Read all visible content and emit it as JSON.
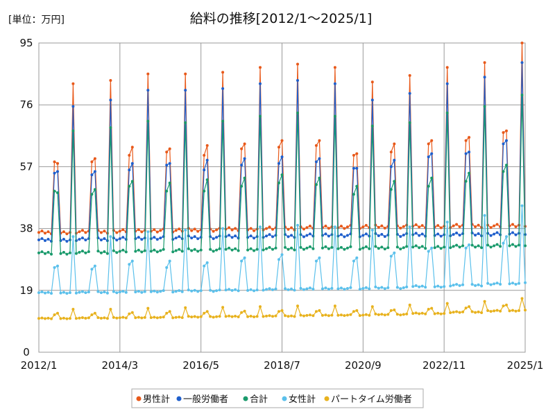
{
  "chart_data": {
    "type": "line",
    "title": "給料の推移[2012/1～2025/1]",
    "unit_label": "[単位：万円]",
    "x_start": "2012-01",
    "x_end": "2025-01",
    "x_tick_labels": [
      "2012/1",
      "2014/3",
      "2016/5",
      "2018/7",
      "2020/9",
      "2022/11",
      "2025/1"
    ],
    "y_tick_labels": [
      "0",
      "19",
      "38",
      "57",
      "76",
      "95"
    ],
    "ylim": [
      0,
      95
    ],
    "grid": true,
    "legend_position": "bottom",
    "series": [
      {
        "name": "男性計",
        "color": "#E8591A",
        "base": [
          36.8,
          37.0,
          37.2,
          37.4,
          37.6,
          37.8,
          38.0,
          38.3,
          38.5,
          38.6,
          38.7,
          38.8,
          38.8,
          38.9
        ],
        "june": [
          58.5,
          58.5,
          60.5,
          61.5,
          60.5,
          62.5,
          63.0,
          63.5,
          60.5,
          61.5,
          64.0,
          65.0,
          67.5,
          null
        ],
        "july": [
          58.0,
          59.5,
          63.0,
          62.5,
          63.5,
          64.0,
          65.0,
          65.0,
          61.0,
          64.0,
          65.0,
          66.0,
          68.0,
          null
        ],
        "dec": [
          82.5,
          83.5,
          85.5,
          85.5,
          86.0,
          87.5,
          88.5,
          87.5,
          83.0,
          85.0,
          87.5,
          89.0,
          95.0,
          null
        ]
      },
      {
        "name": "一般労働者",
        "color": "#1F5FCC",
        "base": [
          34.5,
          34.7,
          34.9,
          35.1,
          35.3,
          35.5,
          35.7,
          35.9,
          35.9,
          36.0,
          36.1,
          36.2,
          36.3,
          36.4
        ],
        "june": [
          55.0,
          54.5,
          56.0,
          57.5,
          56.0,
          57.5,
          58.0,
          58.5,
          56.5,
          57.0,
          60.0,
          61.0,
          64.0,
          null
        ],
        "july": [
          55.5,
          55.5,
          58.0,
          58.0,
          59.0,
          59.5,
          60.0,
          59.5,
          56.5,
          59.0,
          61.0,
          61.5,
          65.0,
          null
        ],
        "dec": [
          75.5,
          77.5,
          80.5,
          80.5,
          81.0,
          82.5,
          83.5,
          82.5,
          77.5,
          79.5,
          82.5,
          84.5,
          89.0,
          null
        ]
      },
      {
        "name": "合計",
        "color": "#1A9A6C",
        "base": [
          30.5,
          30.7,
          31.0,
          31.2,
          31.4,
          31.6,
          31.8,
          32.0,
          32.0,
          32.1,
          32.3,
          32.5,
          32.7,
          32.9
        ],
        "june": [
          49.5,
          48.5,
          51.0,
          49.5,
          49.5,
          51.0,
          52.0,
          51.5,
          48.5,
          50.0,
          51.0,
          52.5,
          55.5,
          null
        ],
        "july": [
          49.0,
          50.0,
          52.5,
          52.0,
          53.0,
          53.5,
          54.5,
          53.5,
          51.0,
          52.5,
          53.5,
          55.0,
          57.5,
          null
        ],
        "dec": [
          68.0,
          69.0,
          71.0,
          70.5,
          71.0,
          72.5,
          73.5,
          72.5,
          69.5,
          70.5,
          73.5,
          75.5,
          79.0,
          null
        ]
      },
      {
        "name": "女性計",
        "color": "#5BC0EB",
        "base": [
          18.3,
          18.4,
          18.5,
          18.7,
          18.9,
          19.1,
          19.3,
          19.5,
          19.6,
          19.8,
          20.2,
          20.6,
          21.0,
          21.5
        ],
        "june": [
          26.0,
          25.5,
          27.0,
          26.0,
          26.5,
          28.0,
          28.5,
          28.0,
          28.0,
          29.5,
          31.0,
          32.0,
          33.5,
          null
        ],
        "july": [
          26.5,
          26.5,
          28.0,
          28.0,
          27.5,
          29.0,
          30.0,
          29.0,
          29.0,
          30.5,
          32.0,
          33.0,
          35.5,
          null
        ],
        "dec": [
          35.5,
          35.5,
          37.0,
          37.5,
          38.0,
          38.5,
          39.0,
          38.5,
          37.5,
          38.5,
          40.0,
          42.0,
          45.0,
          null
        ]
      },
      {
        "name": "パートタイム労働者",
        "color": "#E8B21E",
        "base": [
          10.4,
          10.5,
          10.6,
          10.7,
          10.9,
          11.0,
          11.1,
          11.3,
          11.4,
          11.6,
          11.9,
          12.3,
          12.7,
          13.0
        ],
        "june": [
          11.5,
          11.5,
          11.8,
          12.0,
          12.0,
          12.2,
          12.5,
          12.5,
          12.5,
          12.8,
          13.2,
          13.6,
          14.2,
          null
        ],
        "july": [
          12.0,
          12.0,
          12.2,
          12.5,
          12.5,
          12.6,
          12.8,
          12.8,
          12.8,
          13.0,
          13.5,
          14.0,
          14.5,
          null
        ],
        "dec": [
          13.2,
          13.2,
          13.5,
          13.7,
          13.8,
          14.0,
          14.2,
          14.2,
          14.0,
          14.5,
          15.0,
          15.6,
          16.5,
          null
        ]
      }
    ]
  }
}
